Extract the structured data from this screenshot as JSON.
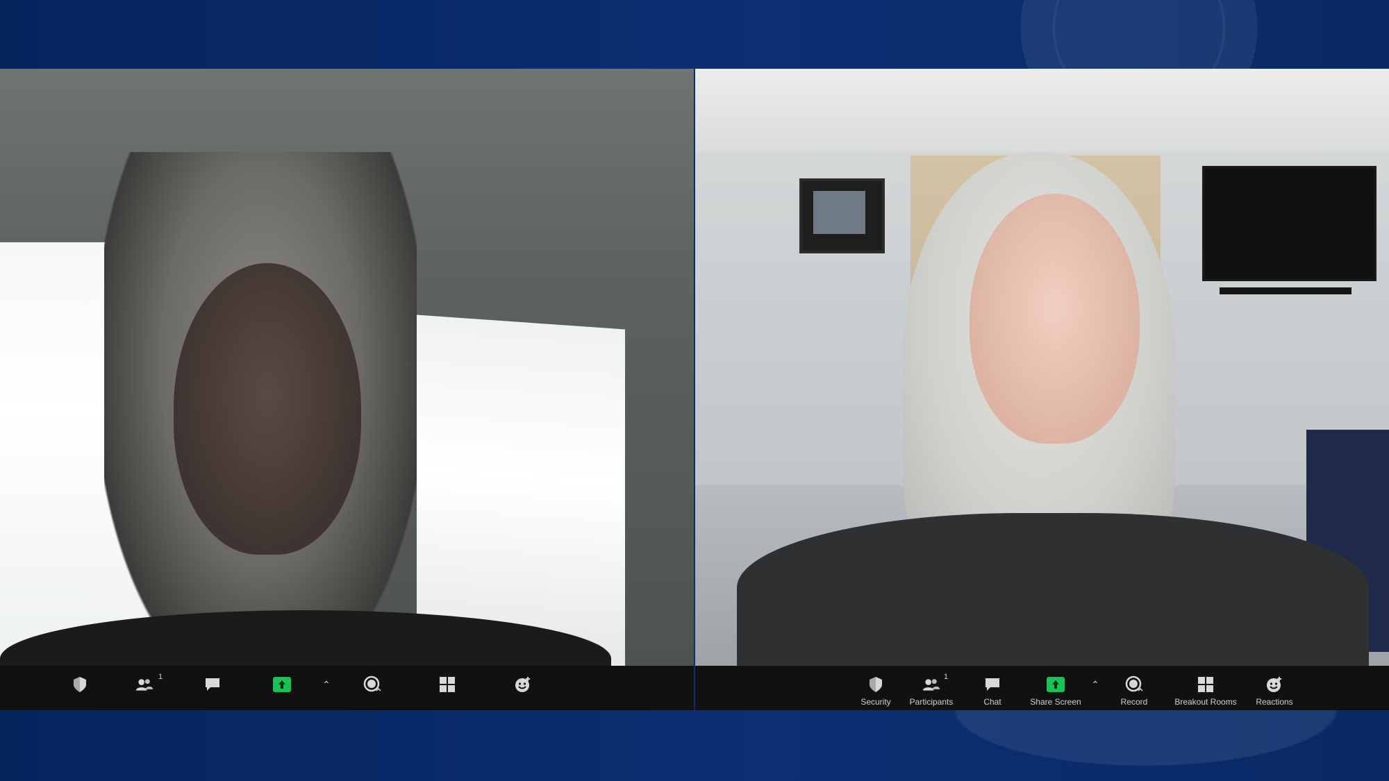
{
  "meeting": {
    "left_video": {
      "participant": ""
    },
    "right_video": {
      "participant": ""
    }
  },
  "toolbar_left": {
    "participants_count": "1"
  },
  "toolbar_right": {
    "security_label": "Security",
    "participants_label": "Participants",
    "participants_count": "1",
    "chat_label": "Chat",
    "share_screen_label": "Share Screen",
    "record_label": "Record",
    "breakout_rooms_label": "Breakout Rooms",
    "reactions_label": "Reactions"
  },
  "colors": {
    "background": "#0a2a6a",
    "toolbar": "#111111",
    "share_green": "#16c456"
  },
  "icons": {
    "security": "shield-icon",
    "participants": "people-icon",
    "chat": "chat-bubble-icon",
    "share": "share-screen-icon",
    "record": "record-icon",
    "breakout": "grid-icon",
    "reactions": "emoji-icon"
  }
}
